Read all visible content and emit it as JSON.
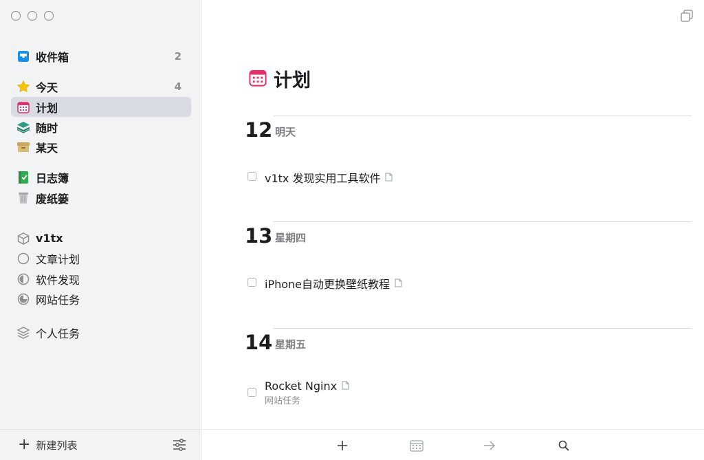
{
  "sidebar": {
    "inbox": {
      "label": "收件箱",
      "count": "2"
    },
    "today": {
      "label": "今天",
      "count": "4"
    },
    "upcoming": {
      "label": "计划"
    },
    "anytime": {
      "label": "随时"
    },
    "someday": {
      "label": "某天"
    },
    "logbook": {
      "label": "日志簿"
    },
    "trash": {
      "label": "废纸篓"
    },
    "area_v1tx": {
      "label": "v1tx"
    },
    "projects": [
      {
        "label": "文章计划"
      },
      {
        "label": "软件发现"
      },
      {
        "label": "网站任务"
      }
    ],
    "area_personal": {
      "label": "个人任务"
    },
    "footer": {
      "new_list_label": "新建列表"
    }
  },
  "main": {
    "title": "计划",
    "days": [
      {
        "num": "12",
        "name": "明天",
        "tasks": [
          {
            "title": "v1tx 发现实用工具软件"
          }
        ]
      },
      {
        "num": "13",
        "name": "星期四",
        "tasks": [
          {
            "title": "iPhone自动更换壁纸教程"
          }
        ]
      },
      {
        "num": "14",
        "name": "星期五",
        "tasks": [
          {
            "title": "Rocket Nginx",
            "project": "网站任务"
          }
        ]
      }
    ]
  },
  "colors": {
    "inbox": "#1a8fe3",
    "today": "#f7c200",
    "upcoming": "#e0326b",
    "anytime": "#2f9a84",
    "someday": "#c8a85a",
    "logbook": "#35a852",
    "sidebar_bg": "#f2f3f5",
    "active_item_bg": "#d9dbe2"
  },
  "icons": [
    "inbox-icon",
    "star-icon",
    "calendar-icon",
    "layers-icon",
    "archive-box-icon",
    "logbook-icon",
    "trash-icon",
    "cube-icon",
    "circle-icon",
    "half-pie-icon",
    "pie-icon",
    "stack-icon",
    "plus-icon",
    "sliders-icon",
    "duplicate-icon",
    "note-icon",
    "arrow-right-icon",
    "search-icon"
  ]
}
